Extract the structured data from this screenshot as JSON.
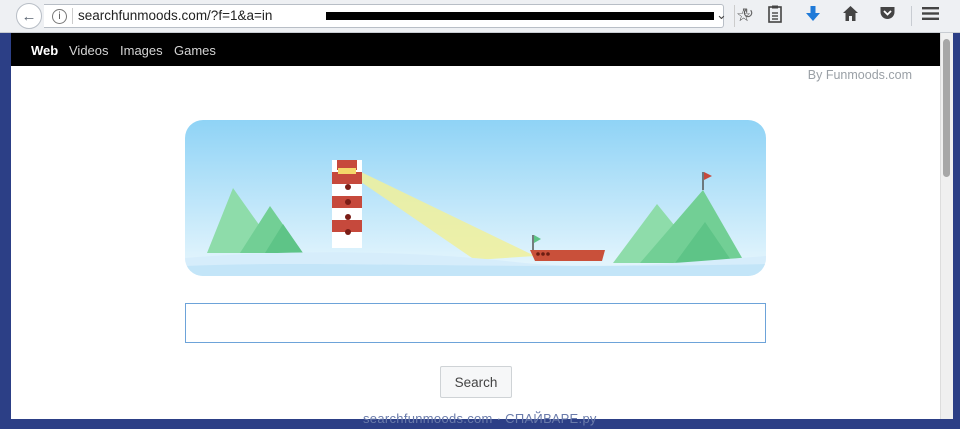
{
  "browser": {
    "url": "searchfunmoods.com/?f=1&a=in",
    "info_glyph": "i",
    "chevron": "⌄",
    "reload": "↻",
    "icons": {
      "back": "back-arrow-icon",
      "bookmark": "star-icon",
      "reading_list": "clipboard-icon",
      "download": "download-arrow-icon",
      "home": "home-icon",
      "pocket": "pocket-icon",
      "menu": "hamburger-menu-icon"
    }
  },
  "page": {
    "nav": [
      {
        "label": "Web"
      },
      {
        "label": "Videos"
      },
      {
        "label": "Images"
      },
      {
        "label": "Games"
      }
    ],
    "brand": "By Funmoods.com",
    "search_placeholder": "",
    "search_button": "Search",
    "partial_footer": "Funmoods"
  },
  "watermark": "searchfunmoods.com · СПАЙВАРЕ.ру",
  "colors": {
    "nav_bg": "#000000",
    "sky": "#8fd3f6",
    "lighthouse_red": "#c6493c",
    "ship_red": "#c9503a",
    "beam": "#f0f09a",
    "mountain_green": "#7fd6a0"
  }
}
